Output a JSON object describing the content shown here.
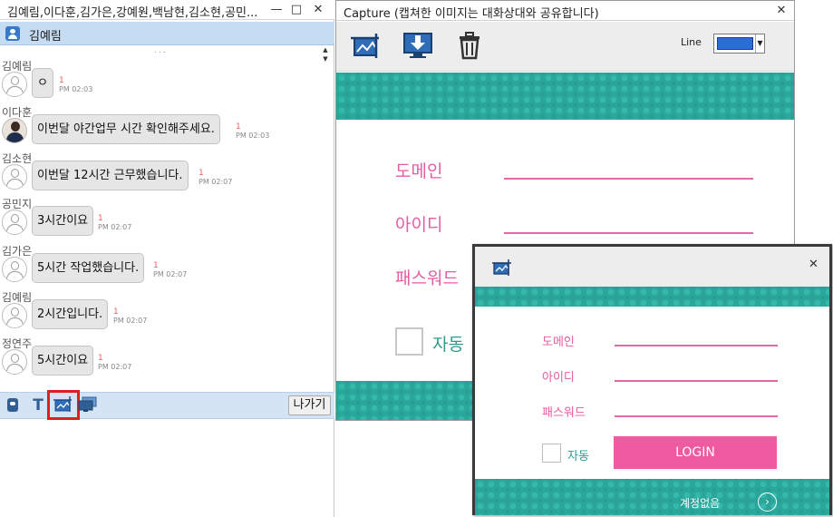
{
  "chat": {
    "title": "김예림,이다훈,김가은,강예원,백남현,김소현,공민...",
    "window_controls": {
      "minimize": "—",
      "maximize": "□",
      "close": "✕"
    },
    "user_name": "김예림",
    "splitter": "...",
    "messages": [
      {
        "sender": "김예림",
        "text": "ㅇ",
        "count": "1",
        "time": "PM 02:03",
        "avatar": "default-avatar-icon"
      },
      {
        "sender": "이다훈",
        "text": "이번달 야간업무 시간 확인해주세요.",
        "count": "1",
        "time": "PM 02:03",
        "avatar": "photo-avatar"
      },
      {
        "sender": "김소현",
        "text": "이번달 12시간 근무했습니다.",
        "count": "1",
        "time": "PM 02:07",
        "avatar": "default-avatar-icon"
      },
      {
        "sender": "공민지",
        "text": "3시간이요",
        "count": "1",
        "time": "PM 02:07",
        "avatar": "default-avatar-icon"
      },
      {
        "sender": "김가은",
        "text": "5시간 작업했습니다.",
        "count": "1",
        "time": "PM 02:07",
        "avatar": "default-avatar-icon"
      },
      {
        "sender": "김예림",
        "text": "2시간입니다.",
        "count": "1",
        "time": "PM 02:07",
        "avatar": "default-avatar-icon"
      },
      {
        "sender": "정연주",
        "text": "5시간이요",
        "count": "1",
        "time": "PM 02:07",
        "avatar": "default-avatar-icon"
      }
    ],
    "toolbar": {
      "text_tool": "T",
      "exit_label": "나가기",
      "icons": [
        "emoticon-icon",
        "text-icon",
        "screen-capture-icon",
        "screen-share-icon"
      ]
    }
  },
  "capture": {
    "title": "Capture (캡쳐한 이미지는 대화상대와 공유합니다)",
    "close": "✕",
    "tools": [
      "capture-image-icon",
      "download-icon",
      "trash-icon"
    ],
    "line_label": "Line",
    "line_color": "#2b6fd6",
    "form": {
      "domain_label": "도메인",
      "id_label": "아이디",
      "password_label": "패스워드",
      "auto_label": "자동"
    }
  },
  "popup": {
    "close": "✕",
    "form": {
      "domain_label": "도메인",
      "id_label": "아이디",
      "password_label": "패스워드",
      "auto_label": "자동",
      "login_label": "LOGIN",
      "no_account_label": "계정없음",
      "arrow": "›"
    }
  },
  "colors": {
    "teal": "#2aa69b",
    "pink": "#e75ba2",
    "login_button": "#ef5aa1",
    "chat_header": "#c5dcf2",
    "highlight_red": "#e01e1e"
  }
}
